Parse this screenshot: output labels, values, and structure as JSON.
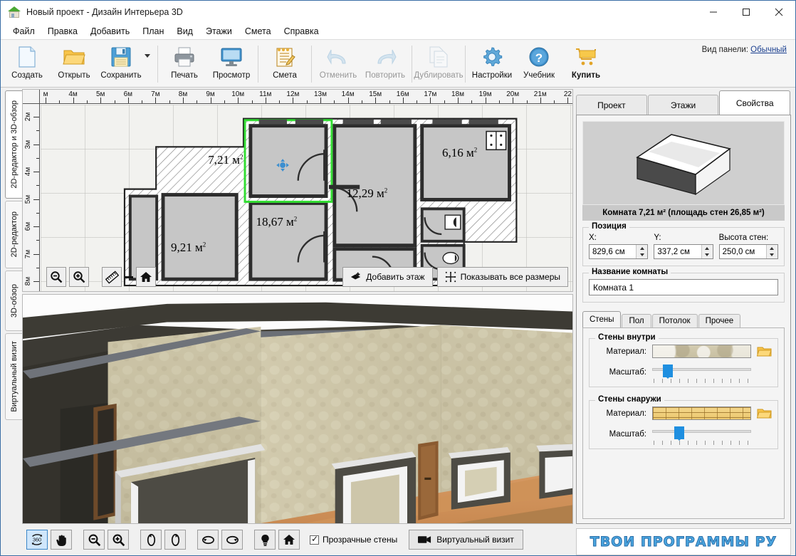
{
  "window": {
    "title": "Новый проект - Дизайн Интерьера 3D",
    "minimize": "—",
    "maximize": "☐",
    "close": "✕"
  },
  "menu": [
    "Файл",
    "Правка",
    "Добавить",
    "План",
    "Вид",
    "Этажи",
    "Смета",
    "Справка"
  ],
  "toolbar": {
    "buttons": [
      {
        "label": "Создать",
        "icon": "new-file-icon",
        "enabled": true
      },
      {
        "label": "Открыть",
        "icon": "open-folder-icon",
        "enabled": true
      },
      {
        "label": "Сохранить",
        "icon": "save-disk-icon",
        "enabled": true
      },
      {
        "label": "Печать",
        "icon": "printer-icon",
        "enabled": true
      },
      {
        "label": "Просмотр",
        "icon": "monitor-icon",
        "enabled": true
      },
      {
        "label": "Смета",
        "icon": "estimate-notepad-icon",
        "enabled": true
      },
      {
        "label": "Отменить",
        "icon": "undo-icon",
        "enabled": false
      },
      {
        "label": "Повторить",
        "icon": "redo-icon",
        "enabled": false
      },
      {
        "label": "Дублировать",
        "icon": "duplicate-icon",
        "enabled": false
      },
      {
        "label": "Настройки",
        "icon": "gear-icon",
        "enabled": true
      },
      {
        "label": "Учебник",
        "icon": "help-question-icon",
        "enabled": true
      },
      {
        "label": "Купить",
        "icon": "cart-icon",
        "enabled": true
      }
    ],
    "panel_view_label": "Вид панели:",
    "panel_view_value": "Обычный"
  },
  "left_tabs": [
    {
      "label": "2D-редактор и 3D-обзор",
      "active": true
    },
    {
      "label": "2D-редактор",
      "active": false
    },
    {
      "label": "3D-обзор",
      "active": false
    },
    {
      "label": "Виртуальный визит",
      "active": false
    }
  ],
  "plan": {
    "ruler_h": [
      "м",
      "4м",
      "5м",
      "6м",
      "7м",
      "8м",
      "9м",
      "10м",
      "11м",
      "12м",
      "13м",
      "14м",
      "15м",
      "16м",
      "17м",
      "18м",
      "19м",
      "20м",
      "21м",
      "22"
    ],
    "ruler_v": [
      "2м",
      "3м",
      "4м",
      "5м",
      "6м",
      "7м",
      "8м"
    ],
    "rooms": [
      {
        "area": "7,21 м",
        "sup": "2",
        "selected": true
      },
      {
        "area": "18,67 м",
        "sup": "2",
        "selected": false
      },
      {
        "area": "9,21 м",
        "sup": "2",
        "selected": false
      },
      {
        "area": "12,29 м",
        "sup": "2",
        "selected": false
      },
      {
        "area": "6,16 м",
        "sup": "2",
        "selected": false
      }
    ],
    "zoom_out": "zoom-out-icon",
    "zoom_in": "zoom-in-icon",
    "ruler_tool": "ruler-icon",
    "home_tool": "home-icon",
    "add_floor_label": "Добавить этаж",
    "show_dims_label": "Показывать все размеры"
  },
  "bottom_bar": {
    "buttons": [
      {
        "icon": "orbit-360-icon",
        "selected": true
      },
      {
        "icon": "pan-hand-icon",
        "selected": false
      },
      {
        "icon": "zoom-out-icon",
        "selected": false
      },
      {
        "icon": "zoom-in-icon",
        "selected": false
      },
      {
        "icon": "rotate-left-icon",
        "selected": false
      },
      {
        "icon": "rotate-right-icon",
        "selected": false
      },
      {
        "icon": "tilt-up-icon",
        "selected": false
      },
      {
        "icon": "tilt-down-icon",
        "selected": false
      },
      {
        "icon": "light-bulb-icon",
        "selected": false
      },
      {
        "icon": "home-icon",
        "selected": false
      }
    ],
    "transparent_walls_label": "Прозрачные стены",
    "transparent_walls_checked": true,
    "virtual_visit_label": "Виртуальный визит",
    "virtual_visit_icon": "video-camera-icon"
  },
  "right_panel": {
    "tabs": [
      {
        "label": "Проект",
        "active": false
      },
      {
        "label": "Этажи",
        "active": false
      },
      {
        "label": "Свойства",
        "active": true
      }
    ],
    "preview_caption": "Комната 7,21 м²  (площадь стен 26,85 м²)",
    "position": {
      "title": "Позиция",
      "x_label": "X:",
      "x_value": "829,6 см",
      "y_label": "Y:",
      "y_value": "337,2 см",
      "h_label": "Высота стен:",
      "h_value": "250,0 см"
    },
    "room_name": {
      "title": "Название комнаты",
      "value": "Комната 1"
    },
    "sub_tabs": [
      {
        "label": "Стены",
        "active": true
      },
      {
        "label": "Пол",
        "active": false
      },
      {
        "label": "Потолок",
        "active": false
      },
      {
        "label": "Прочее",
        "active": false
      }
    ],
    "inner_walls": {
      "title": "Стены внутри",
      "material_label": "Материал:",
      "scale_label": "Масштаб:",
      "scale_percent": 11,
      "browse_icon": "folder-open-icon"
    },
    "outer_walls": {
      "title": "Стены снаружи",
      "material_label": "Материал:",
      "scale_label": "Масштаб:",
      "scale_percent": 22,
      "browse_icon": "folder-open-icon"
    },
    "logo": "ТВОИ ПРОГРАММЫ РУ"
  },
  "colors": {
    "accent": "#1f8fe0",
    "selection_green": "#33dd33",
    "window_border": "#3a6ea5",
    "wall_dark": "#3a3a3a",
    "room_fill": "#c6c6c6"
  }
}
